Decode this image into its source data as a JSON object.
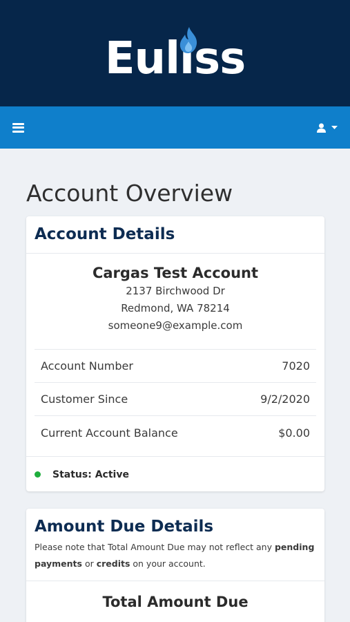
{
  "brand": {
    "logo_text": "Euliss",
    "colors": {
      "brand_bar": "#06264a",
      "nav_bar": "#0f7fcb",
      "flame": "#3a8fd8"
    }
  },
  "nav": {
    "menu_icon": "hamburger-icon",
    "user_icon": "user-icon",
    "caret_icon": "caret-down-icon"
  },
  "page": {
    "title": "Account Overview"
  },
  "account_details": {
    "title": "Account Details",
    "name": "Cargas Test Account",
    "address_line1": "2137 Birchwood Dr",
    "address_line2": "Redmond, WA 78214",
    "email": "someone9@example.com",
    "rows": [
      {
        "label": "Account Number",
        "value": "7020"
      },
      {
        "label": "Customer Since",
        "value": "9/2/2020"
      },
      {
        "label": "Current Account Balance",
        "value": "$0.00"
      }
    ],
    "status": "Status: Active",
    "status_color": "#1fae3d"
  },
  "amount_due": {
    "title": "Amount Due Details",
    "note_part1": "Please note that Total Amount Due may not reflect any ",
    "note_bold1": "pending payments",
    "note_part2": " or ",
    "note_bold2": "credits",
    "note_part3": " on your account.",
    "total_title": "Total Amount Due"
  }
}
